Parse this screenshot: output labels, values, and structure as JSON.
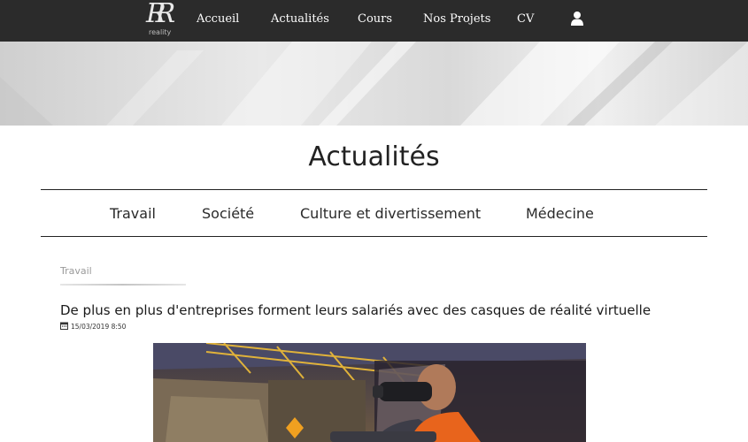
{
  "header": {
    "logo_text": "reality",
    "nav": [
      "Accueil",
      "Actualités",
      "Cours",
      "Nos Projets",
      "CV"
    ]
  },
  "page": {
    "title": "Actualités"
  },
  "categories": [
    "Travail",
    "Société",
    "Culture et divertissement",
    "Médecine"
  ],
  "article": {
    "category": "Travail",
    "title": "De plus en plus d'entreprises forment leurs salariés avec des casques de réalité virtuelle",
    "date": "15/03/2019 8:50"
  },
  "colors": {
    "navbar": "#2b2b2b",
    "text": "#222222",
    "muted": "#9a9a9a"
  },
  "icons": [
    "user-icon",
    "calendar-icon"
  ]
}
